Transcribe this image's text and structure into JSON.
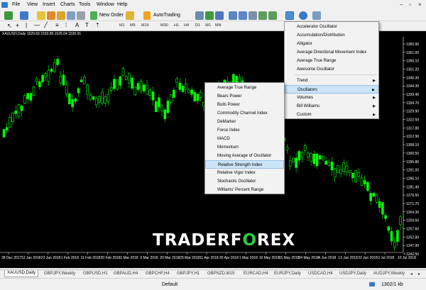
{
  "menubar": {
    "items": [
      "File",
      "View",
      "Insert",
      "Charts",
      "Tools",
      "Window",
      "Help"
    ],
    "window_controls": [
      "−",
      "▫",
      "×"
    ]
  },
  "toolbar": {
    "new_order": "New Order",
    "autotrading": "AutoTrading",
    "timeframes": [
      "M1",
      "M5",
      "M15",
      "M30",
      "H1",
      "H4",
      "D1",
      "W1",
      "MN"
    ]
  },
  "chart": {
    "title": "XAUUSD,Daily  1529.69 1533.89 1525.04 1530.91",
    "price_labels": [
      "1365.90",
      "1361.00",
      "1356.10",
      "1351.20",
      "1346.30",
      "1344.30",
      "1339.40",
      "1334.70",
      "1329.90",
      "1322.50",
      "1317.80",
      "1312.90",
      "1308.10",
      "1300.50",
      "1295.80",
      "1291.00",
      "1286.10",
      "1281.40",
      "1276.50",
      "1271.70",
      "1264.30",
      "1259.50",
      "1257.60",
      "1252.80",
      "1247.90",
      "1242.50"
    ],
    "date_labels": [
      "28 Dec 2017",
      "12 Jan 2018",
      "22 Jan 2018",
      "1 Feb 2018",
      "11 Feb 2018",
      "20 Feb 2018",
      "1 Mar 2018",
      "9 Mar 2018",
      "20 Mar 2018",
      "29 Mar 2018",
      "11 Apr 2018",
      "20 Apr 2018",
      "1 May 2018",
      "10 May 2018",
      "15 May 2018",
      "24 May 2018",
      "4 Jun 2018",
      "13 Jun 2018",
      "22 Jun 2018",
      "3 Jul 2018",
      "10 Jul 2018"
    ],
    "colors": {
      "bull": "#00ff00",
      "bear": "#00ff00",
      "background": "#000000",
      "text": "#ffffff"
    }
  },
  "watermark": {
    "part1": "TRADERF",
    "o": "O",
    "part2": "REX"
  },
  "indicator_menu": {
    "items": [
      {
        "label": "Accelerator Oscillator"
      },
      {
        "label": "Accumulation/Distribution"
      },
      {
        "label": "Alligator"
      },
      {
        "label": "Average Directional Movement Index"
      },
      {
        "label": "Average True Range"
      },
      {
        "label": "Awesome Oscillator"
      },
      {
        "label": "Trend"
      },
      {
        "label": "Oscillators"
      },
      {
        "label": "Volumes"
      },
      {
        "label": "Bill Williams"
      },
      {
        "label": "Custom"
      }
    ]
  },
  "oscillators_menu": {
    "items": [
      "Average True Range",
      "Bears Power",
      "Bulls Power",
      "Commodity Channel Index",
      "DeMarker",
      "Force Index",
      "MACD",
      "Momentum",
      "Moving Average of Oscillator",
      "Relative Strength Index",
      "Relative Vigor Index",
      "Stochastic Oscillator",
      "Williams' Percent Range"
    ],
    "highlighted": "Relative Strength Index"
  },
  "tabs": [
    "XAUUSD,Daily",
    "GBPJPY,Weekly",
    "GBPUSD,H1",
    "GBPAUD,H4",
    "GBPCHF,H4",
    "GBPJPY,H1",
    "GBPNZD,M15",
    "EURCAD,H4",
    "EURJPY,Daily",
    "USDCAD,H4",
    "USDJPY,Daily",
    "AUDJPY,Weekly"
  ],
  "status": {
    "profile": "Default",
    "traffic": "1302/1 kb"
  }
}
